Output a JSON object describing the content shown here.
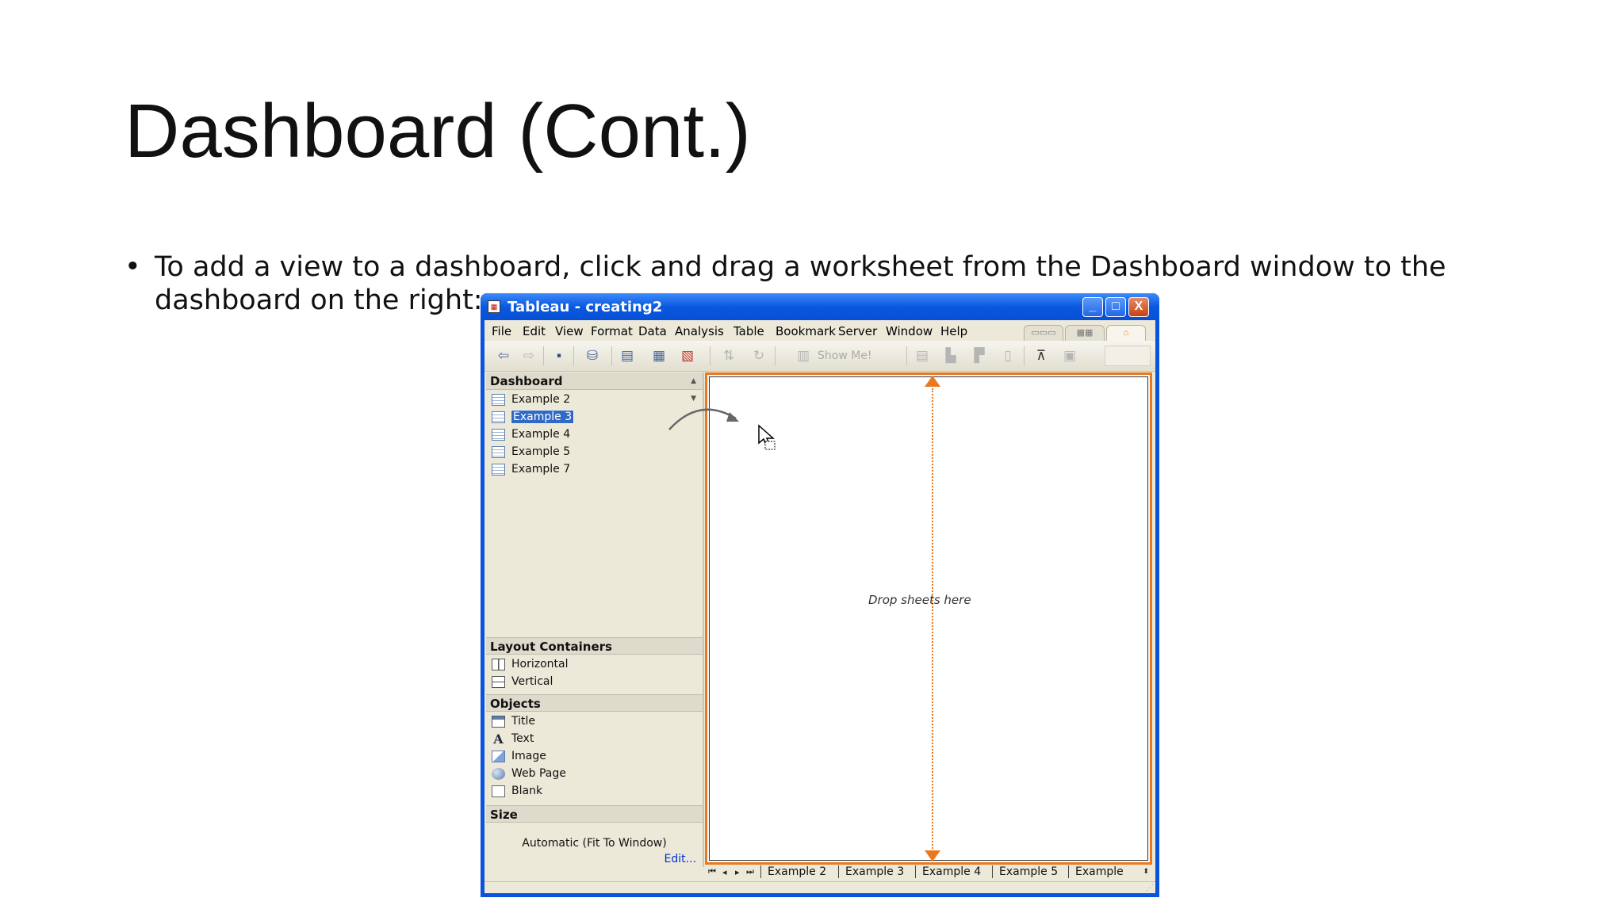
{
  "slide": {
    "title": "Dashboard (Cont.)",
    "bullet": "To add a view to a dashboard, click and drag a worksheet from the Dashboard window to the dashboard on the right:"
  },
  "window": {
    "title": "Tableau - creating2",
    "controls": {
      "minimize": "_",
      "maximize": "□",
      "close": "X"
    }
  },
  "menu": [
    "File",
    "Edit",
    "View",
    "Format",
    "Data",
    "Analysis",
    "Table",
    "Bookmark",
    "Server",
    "Window",
    "Help"
  ],
  "toolbar": {
    "icons": [
      "back-icon",
      "forward-icon",
      "save-icon",
      "connect-data-icon",
      "new-worksheet-icon",
      "new-dashboard-icon",
      "clear-sheet-icon",
      "swap-icon",
      "refresh-icon",
      "show-me-icon",
      "sort-icon",
      "totals-icon",
      "highlight-icon",
      "present-icon",
      "fit-icon"
    ],
    "show_me_label": "Show Me!"
  },
  "panel": {
    "dashboard_header": "Dashboard",
    "worksheets": [
      {
        "label": "Example 2",
        "selected": false
      },
      {
        "label": "Example 3",
        "selected": true
      },
      {
        "label": "Example 4",
        "selected": false
      },
      {
        "label": "Example 5",
        "selected": false
      },
      {
        "label": "Example 7",
        "selected": false
      }
    ],
    "layout_header": "Layout Containers",
    "layout_items": [
      "Horizontal",
      "Vertical"
    ],
    "objects_header": "Objects",
    "objects": [
      "Title",
      "Text",
      "Image",
      "Web Page",
      "Blank"
    ],
    "size_header": "Size",
    "size_value": "Automatic (Fit To Window)",
    "edit_link": "Edit..."
  },
  "canvas": {
    "drop_text": "Drop sheets here",
    "accent": "#e9781f"
  },
  "tabs": [
    "Example 2",
    "Example 3",
    "Example 4",
    "Example 5",
    "Example"
  ],
  "colors": {
    "title_bar": "#0a58e0",
    "selection": "#316ac5",
    "chrome": "#ece9d8"
  }
}
